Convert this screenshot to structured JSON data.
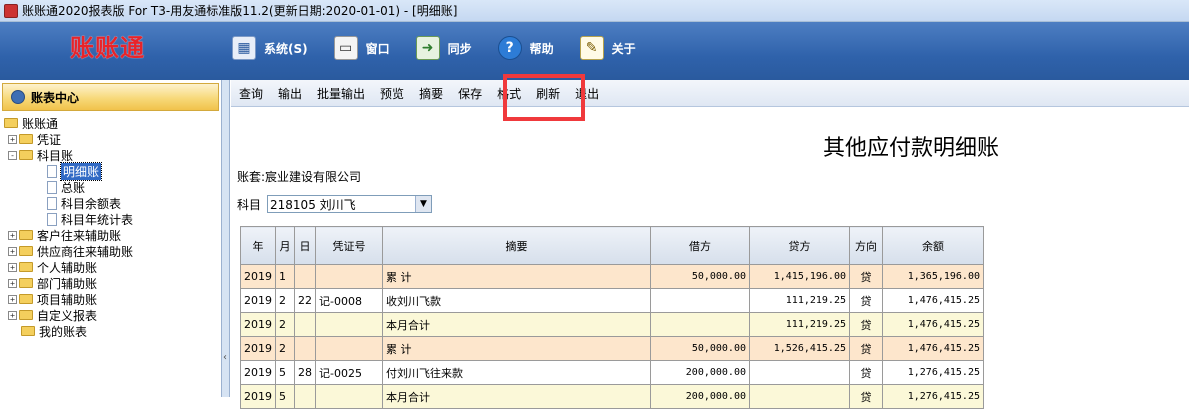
{
  "titlebar": {
    "title": "账账通2020报表版 For T3-用友通标准版11.2(更新日期:2020-01-01) - [明细账]"
  },
  "header": {
    "logo": "账账通",
    "menu": [
      {
        "label": "系统(S)",
        "icon": "system-icon"
      },
      {
        "label": "窗口",
        "icon": "window-icon"
      },
      {
        "label": "同步",
        "icon": "sync-icon"
      },
      {
        "label": "帮助",
        "icon": "help-icon"
      },
      {
        "label": "关于",
        "icon": "about-icon"
      }
    ]
  },
  "sidebar": {
    "title": "账表中心",
    "tree": {
      "root": "账账通",
      "voucher": "凭证",
      "subject_ledger": "科目账",
      "detail": "明细账",
      "general": "总账",
      "balance": "科目余额表",
      "yearly": "科目年统计表",
      "customer": "客户往来辅助账",
      "supplier": "供应商往来辅助账",
      "personal": "个人辅助账",
      "department": "部门辅助账",
      "project": "项目辅助账",
      "custom": "自定义报表",
      "mine": "我的账表"
    }
  },
  "toolbar": {
    "items": [
      "查询",
      "输出",
      "批量输出",
      "预览",
      "摘要",
      "保存",
      "格式",
      "刷新",
      "退出"
    ]
  },
  "report": {
    "title": "其他应付款明细账",
    "account_label": "账套:宸业建设有限公司",
    "subject_label": "科目",
    "subject_value": "218105 刘川飞"
  },
  "table": {
    "headers": [
      "年",
      "月",
      "日",
      "凭证号",
      "摘要",
      "借方",
      "贷方",
      "方向",
      "余额"
    ],
    "rows": [
      {
        "style": "total",
        "year": "2019",
        "month": "1",
        "day": "",
        "voucher": "",
        "summary": "累    计",
        "debit": "50,000.00",
        "credit": "1,415,196.00",
        "dir": "贷",
        "balance": "1,365,196.00"
      },
      {
        "style": "normal",
        "year": "2019",
        "month": "2",
        "day": "22",
        "voucher": "记-0008",
        "summary": "收刘川飞款",
        "debit": "",
        "credit": "111,219.25",
        "dir": "贷",
        "balance": "1,476,415.25"
      },
      {
        "style": "sub",
        "year": "2019",
        "month": "2",
        "day": "",
        "voucher": "",
        "summary": "本月合计",
        "debit": "",
        "credit": "111,219.25",
        "dir": "贷",
        "balance": "1,476,415.25"
      },
      {
        "style": "total",
        "year": "2019",
        "month": "2",
        "day": "",
        "voucher": "",
        "summary": "累    计",
        "debit": "50,000.00",
        "credit": "1,526,415.25",
        "dir": "贷",
        "balance": "1,476,415.25"
      },
      {
        "style": "normal",
        "year": "2019",
        "month": "5",
        "day": "28",
        "voucher": "记-0025",
        "summary": "付刘川飞往来款",
        "debit": "200,000.00",
        "credit": "",
        "dir": "贷",
        "balance": "1,276,415.25"
      },
      {
        "style": "sub",
        "year": "2019",
        "month": "5",
        "day": "",
        "voucher": "",
        "summary": "本月合计",
        "debit": "200,000.00",
        "credit": "",
        "dir": "贷",
        "balance": "1,276,415.25"
      }
    ]
  }
}
